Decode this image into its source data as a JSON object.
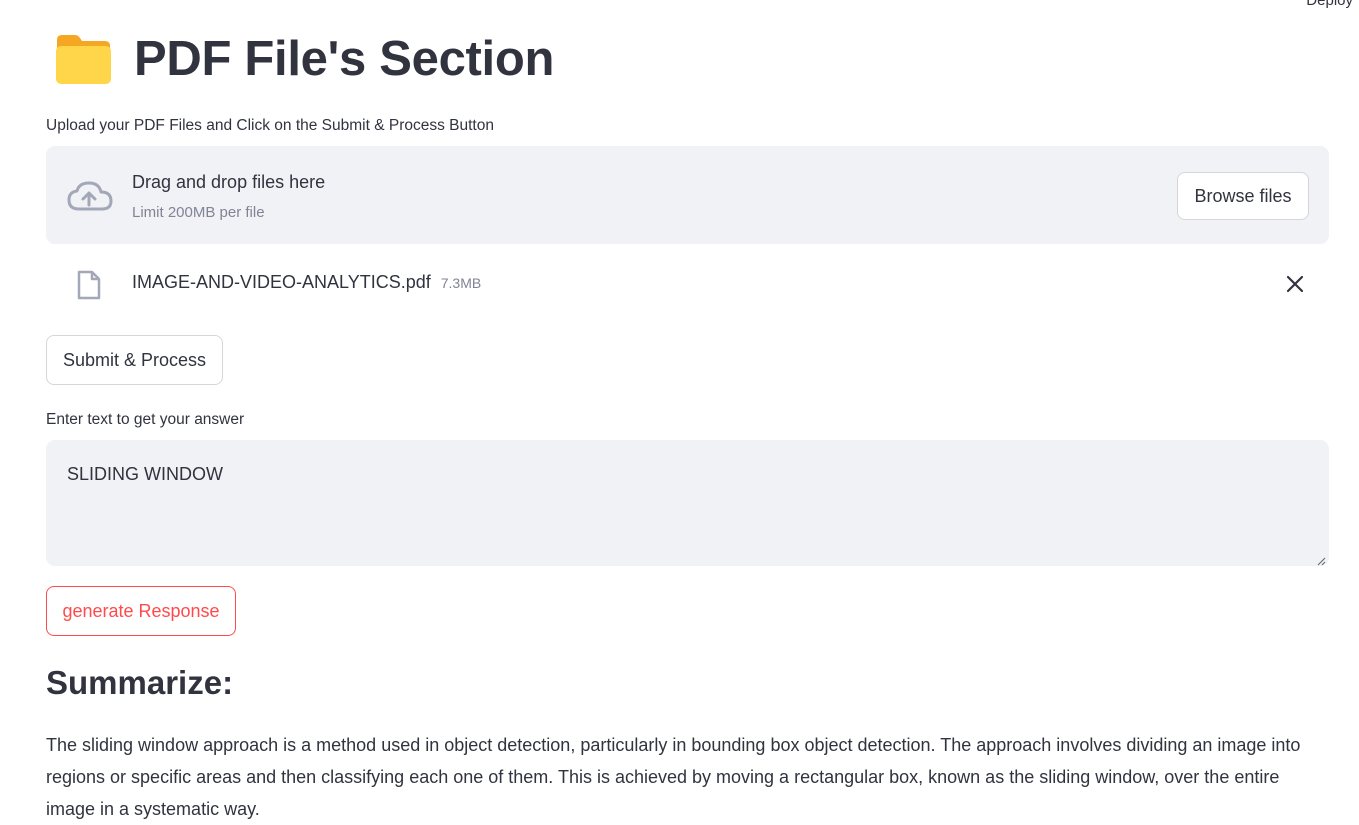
{
  "header": {
    "deploy_label": "Deploy"
  },
  "page": {
    "title": "PDF File's Section",
    "title_icon": "folder-icon"
  },
  "uploader": {
    "label": "Upload your PDF Files and Click on the Submit & Process Button",
    "drop_title": "Drag and drop files here",
    "limit": "Limit 200MB per file",
    "browse_label": "Browse files",
    "files": [
      {
        "name": "IMAGE-AND-VIDEO-ANALYTICS.pdf",
        "size": "7.3MB"
      }
    ]
  },
  "submit_label": "Submit & Process",
  "question": {
    "label": "Enter text to get your answer",
    "value": "SLIDING WINDOW"
  },
  "generate_label": "generate Response",
  "summary": {
    "heading": "Summarize:",
    "text": "The sliding window approach is a method used in object detection, particularly in bounding box object detection. The approach involves dividing an image into regions or specific areas and then classifying each one of them. This is achieved by moving a rectangular box, known as the sliding window, over the entire image in a systematic way."
  },
  "colors": {
    "accent": "#ff4b4b",
    "panel_bg": "#f0f2f6",
    "text": "#31333f",
    "muted": "#808495"
  }
}
